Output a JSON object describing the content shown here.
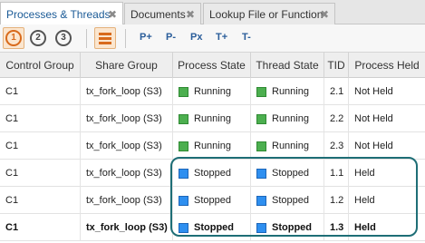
{
  "tabs": [
    {
      "label": "Processes & Threads",
      "active": true
    },
    {
      "label": "Documents",
      "active": false
    },
    {
      "label": "Lookup File or Function",
      "active": false
    }
  ],
  "toolbar": {
    "focus_buttons": [
      "1",
      "2",
      "3"
    ],
    "active_focus": "1",
    "layout_icon": "lines-icon",
    "nav_buttons": [
      "P+",
      "P-",
      "Px",
      "T+",
      "T-"
    ]
  },
  "table": {
    "columns": [
      "Control Group",
      "Share Group",
      "Process State",
      "Thread State",
      "TID",
      "Process Held"
    ],
    "rows": [
      {
        "control_group": "C1",
        "share_group": "tx_fork_loop (S3)",
        "process_state": "Running",
        "thread_state": "Running",
        "tid": "2.1",
        "process_held": "Not Held"
      },
      {
        "control_group": "C1",
        "share_group": "tx_fork_loop (S3)",
        "process_state": "Running",
        "thread_state": "Running",
        "tid": "2.2",
        "process_held": "Not Held"
      },
      {
        "control_group": "C1",
        "share_group": "tx_fork_loop (S3)",
        "process_state": "Running",
        "thread_state": "Running",
        "tid": "2.3",
        "process_held": "Not Held"
      },
      {
        "control_group": "C1",
        "share_group": "tx_fork_loop (S3)",
        "process_state": "Stopped",
        "thread_state": "Stopped",
        "tid": "1.1",
        "process_held": "Held"
      },
      {
        "control_group": "C1",
        "share_group": "tx_fork_loop (S3)",
        "process_state": "Stopped",
        "thread_state": "Stopped",
        "tid": "1.2",
        "process_held": "Held"
      },
      {
        "control_group": "C1",
        "share_group": "tx_fork_loop (S3)",
        "process_state": "Stopped",
        "thread_state": "Stopped",
        "tid": "1.3",
        "process_held": "Held"
      }
    ]
  },
  "colors": {
    "running": "#4caf4f",
    "stopped": "#2e8ff0",
    "highlight_outline": "#1e6e76",
    "active_tab_text": "#1a5a96"
  }
}
